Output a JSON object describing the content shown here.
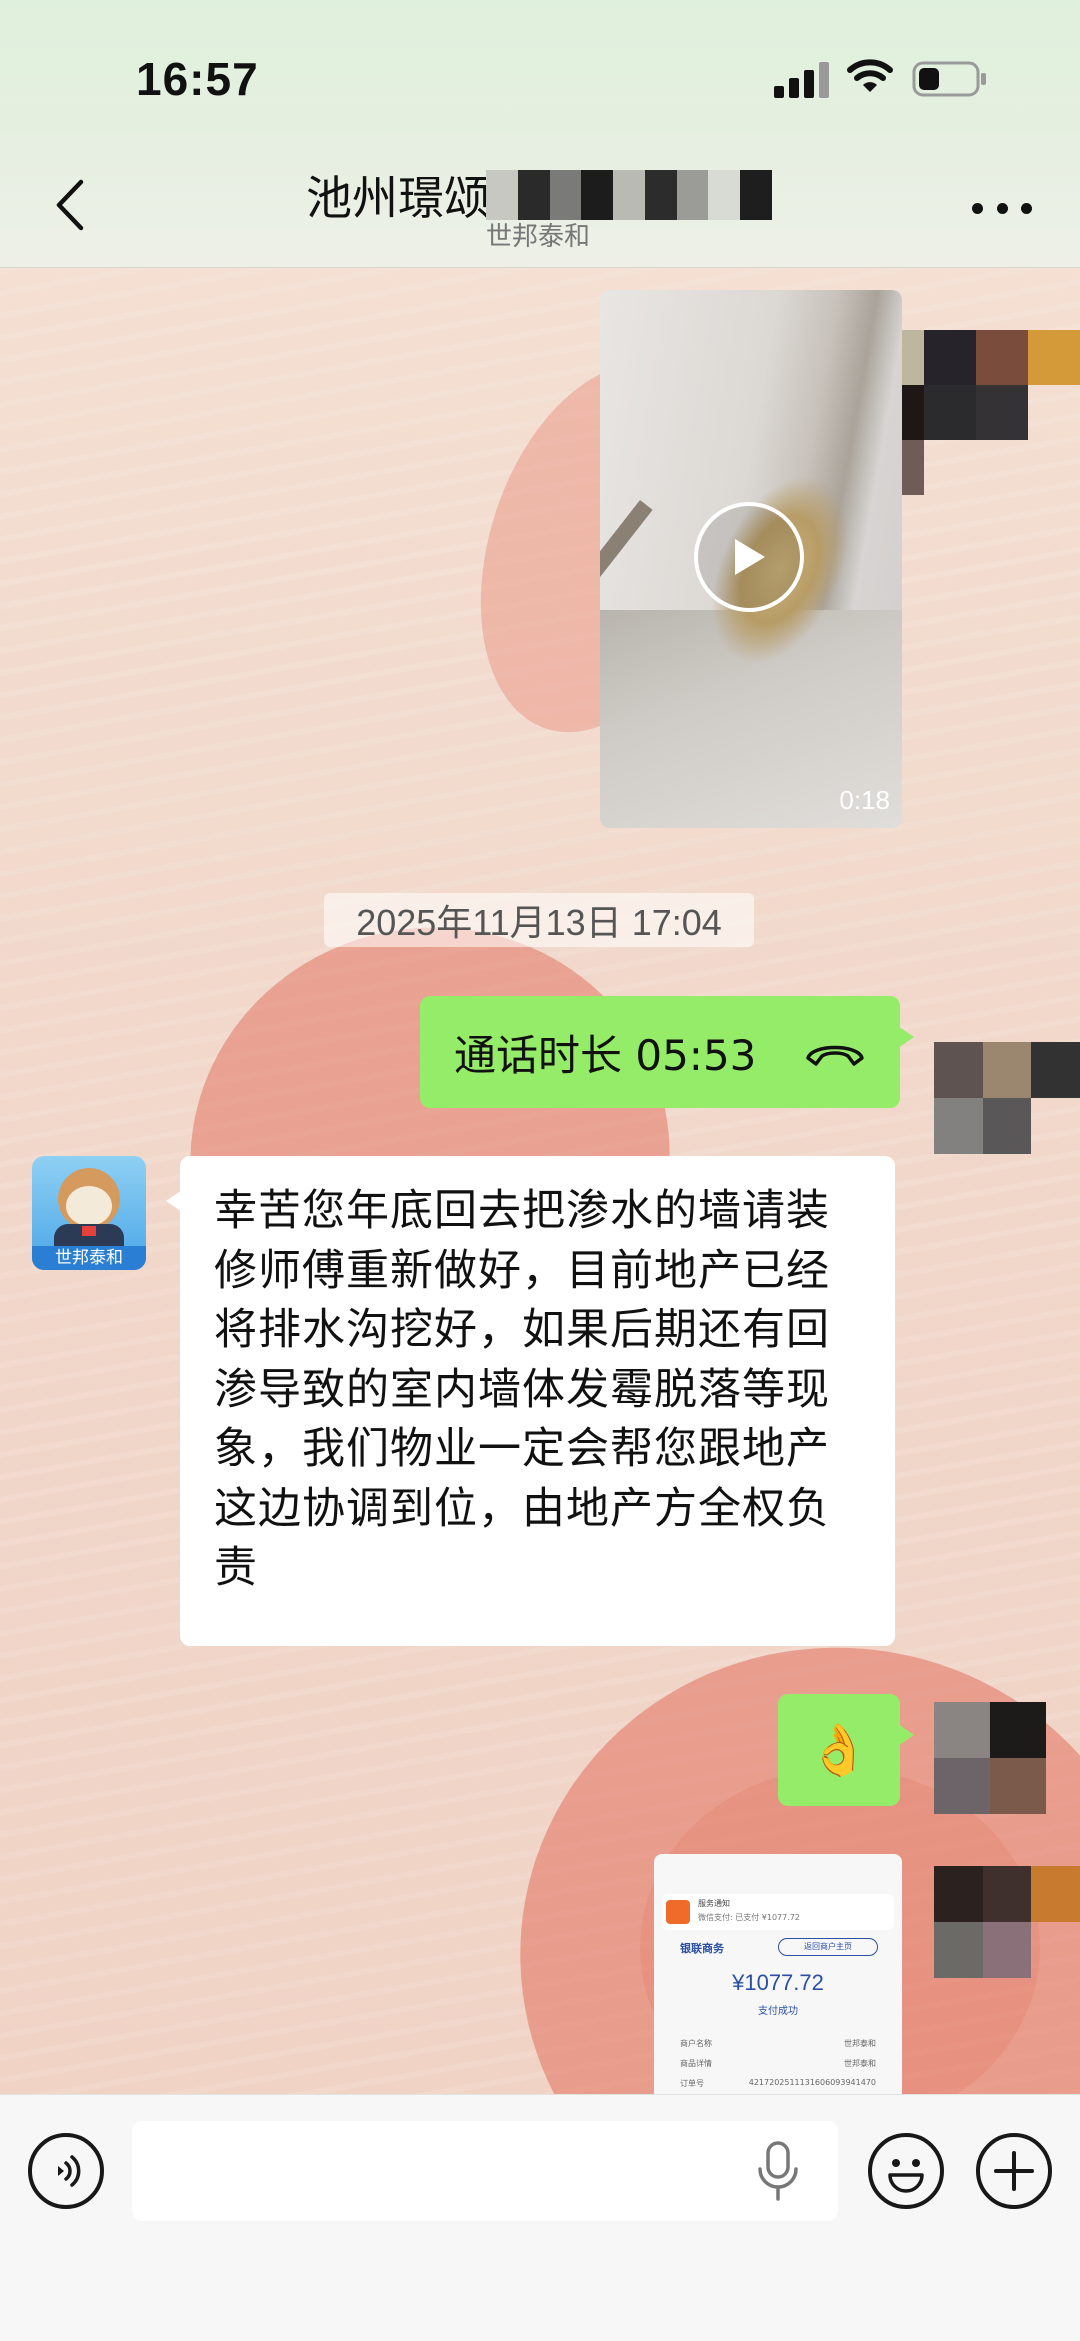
{
  "status_bar": {
    "time": "16:57",
    "signal_icon": "cellular-signal-icon",
    "wifi_icon": "wifi-icon",
    "battery_icon": "battery-icon"
  },
  "header": {
    "back_icon": "chevron-left-icon",
    "title": "池州璟颂",
    "subtitle": "世邦泰和",
    "more_icon": "more-dots-icon"
  },
  "messages": {
    "video": {
      "duration": "0:18",
      "play_icon": "play-icon"
    },
    "timestamp": "2025年11月13日 17:04",
    "call": {
      "text": "通话时长 05:53",
      "icon": "phone-hangup-icon"
    },
    "incoming_text": {
      "sender_avatar_label": "世邦泰和",
      "text": "幸苦您年底回去把渗水的墙请装修师傅重新做好，目前地产已经将排水沟挖好，如果后期还有回渗导致的室内墙体发霉脱落等现象，我们物业一定会帮您跟地产这边协调到位，由地产方全权负责"
    },
    "emoji": {
      "text": "👌"
    },
    "receipt_image": {
      "notice_title": "服务通知",
      "notice_line": "微信支付: 已支付 ¥1077.72",
      "brand": "银联商务",
      "link": "返回商户主页",
      "amount": "¥1077.72",
      "status": "支付成功",
      "rows": [
        {
          "label": "商户名称",
          "value": "世邦泰和"
        },
        {
          "label": "商品详情",
          "value": "世邦泰和"
        },
        {
          "label": "订单号",
          "value": "4217202511131606093941470"
        }
      ]
    }
  },
  "input_bar": {
    "voice_icon": "voice-input-icon",
    "input_value": "",
    "input_placeholder": "",
    "mic_icon": "microphone-icon",
    "emoji_icon": "emoji-icon",
    "plus_icon": "plus-icon"
  },
  "colors": {
    "outgoing_bubble": "#95ec69",
    "incoming_bubble": "#ffffff",
    "header_bg": "#e6efe1",
    "input_bar_bg": "#f7f7f7"
  }
}
